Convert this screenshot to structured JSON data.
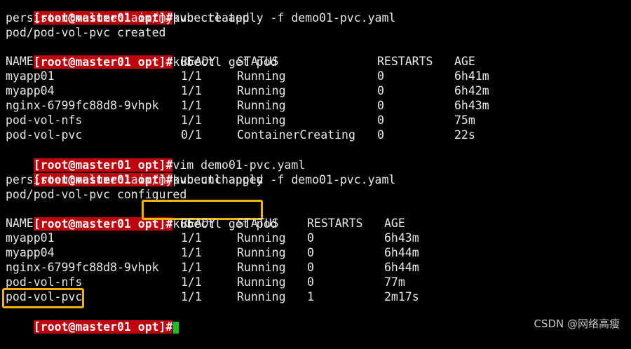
{
  "prompt": "[root@master01 opt]#",
  "commands": {
    "apply1": "kubectl apply -f demo01-pvc.yaml",
    "get1": "kubectl get pod",
    "vim": "vim demo01-pvc.yaml",
    "apply2": "kubectl apply -f demo01-pvc.yaml",
    "get2": "kubectl get pod"
  },
  "apply1_output": [
    "persistentvolumeclaim/mypvc created",
    "pod/pod-vol-pvc created"
  ],
  "apply2_output": [
    "persistentvolumeclaim/mypvc unchanged",
    "pod/pod-vol-pvc configured"
  ],
  "table1": {
    "headers": [
      "NAME",
      "READY",
      "STATUS",
      "RESTARTS",
      "AGE"
    ],
    "rows": [
      [
        "myapp01",
        "1/1",
        "Running",
        "0",
        "6h41m"
      ],
      [
        "myapp04",
        "1/1",
        "Running",
        "0",
        "6h42m"
      ],
      [
        "nginx-6799fc88d8-9vhpk",
        "1/1",
        "Running",
        "0",
        "6h43m"
      ],
      [
        "pod-vol-nfs",
        "1/1",
        "Running",
        "0",
        "75m"
      ],
      [
        "pod-vol-pvc",
        "0/1",
        "ContainerCreating",
        "0",
        "22s"
      ]
    ]
  },
  "table2": {
    "headers": [
      "NAME",
      "READY",
      "STATUS",
      "RESTARTS",
      "AGE"
    ],
    "rows": [
      [
        "myapp01",
        "1/1",
        "Running",
        "0",
        "6h43m"
      ],
      [
        "myapp04",
        "1/1",
        "Running",
        "0",
        "6h44m"
      ],
      [
        "nginx-6799fc88d8-9vhpk",
        "1/1",
        "Running",
        "0",
        "6h44m"
      ],
      [
        "pod-vol-nfs",
        "1/1",
        "Running",
        "0",
        "77m"
      ],
      [
        "pod-vol-pvc",
        "1/1",
        "Running",
        "1",
        "2m17s"
      ]
    ]
  },
  "watermark": "CSDN @网络高瘦",
  "colors": {
    "background": "#000000",
    "prompt_bg": "#c0000a",
    "highlight_box": "#f5b301",
    "cursor": "#19c219"
  }
}
